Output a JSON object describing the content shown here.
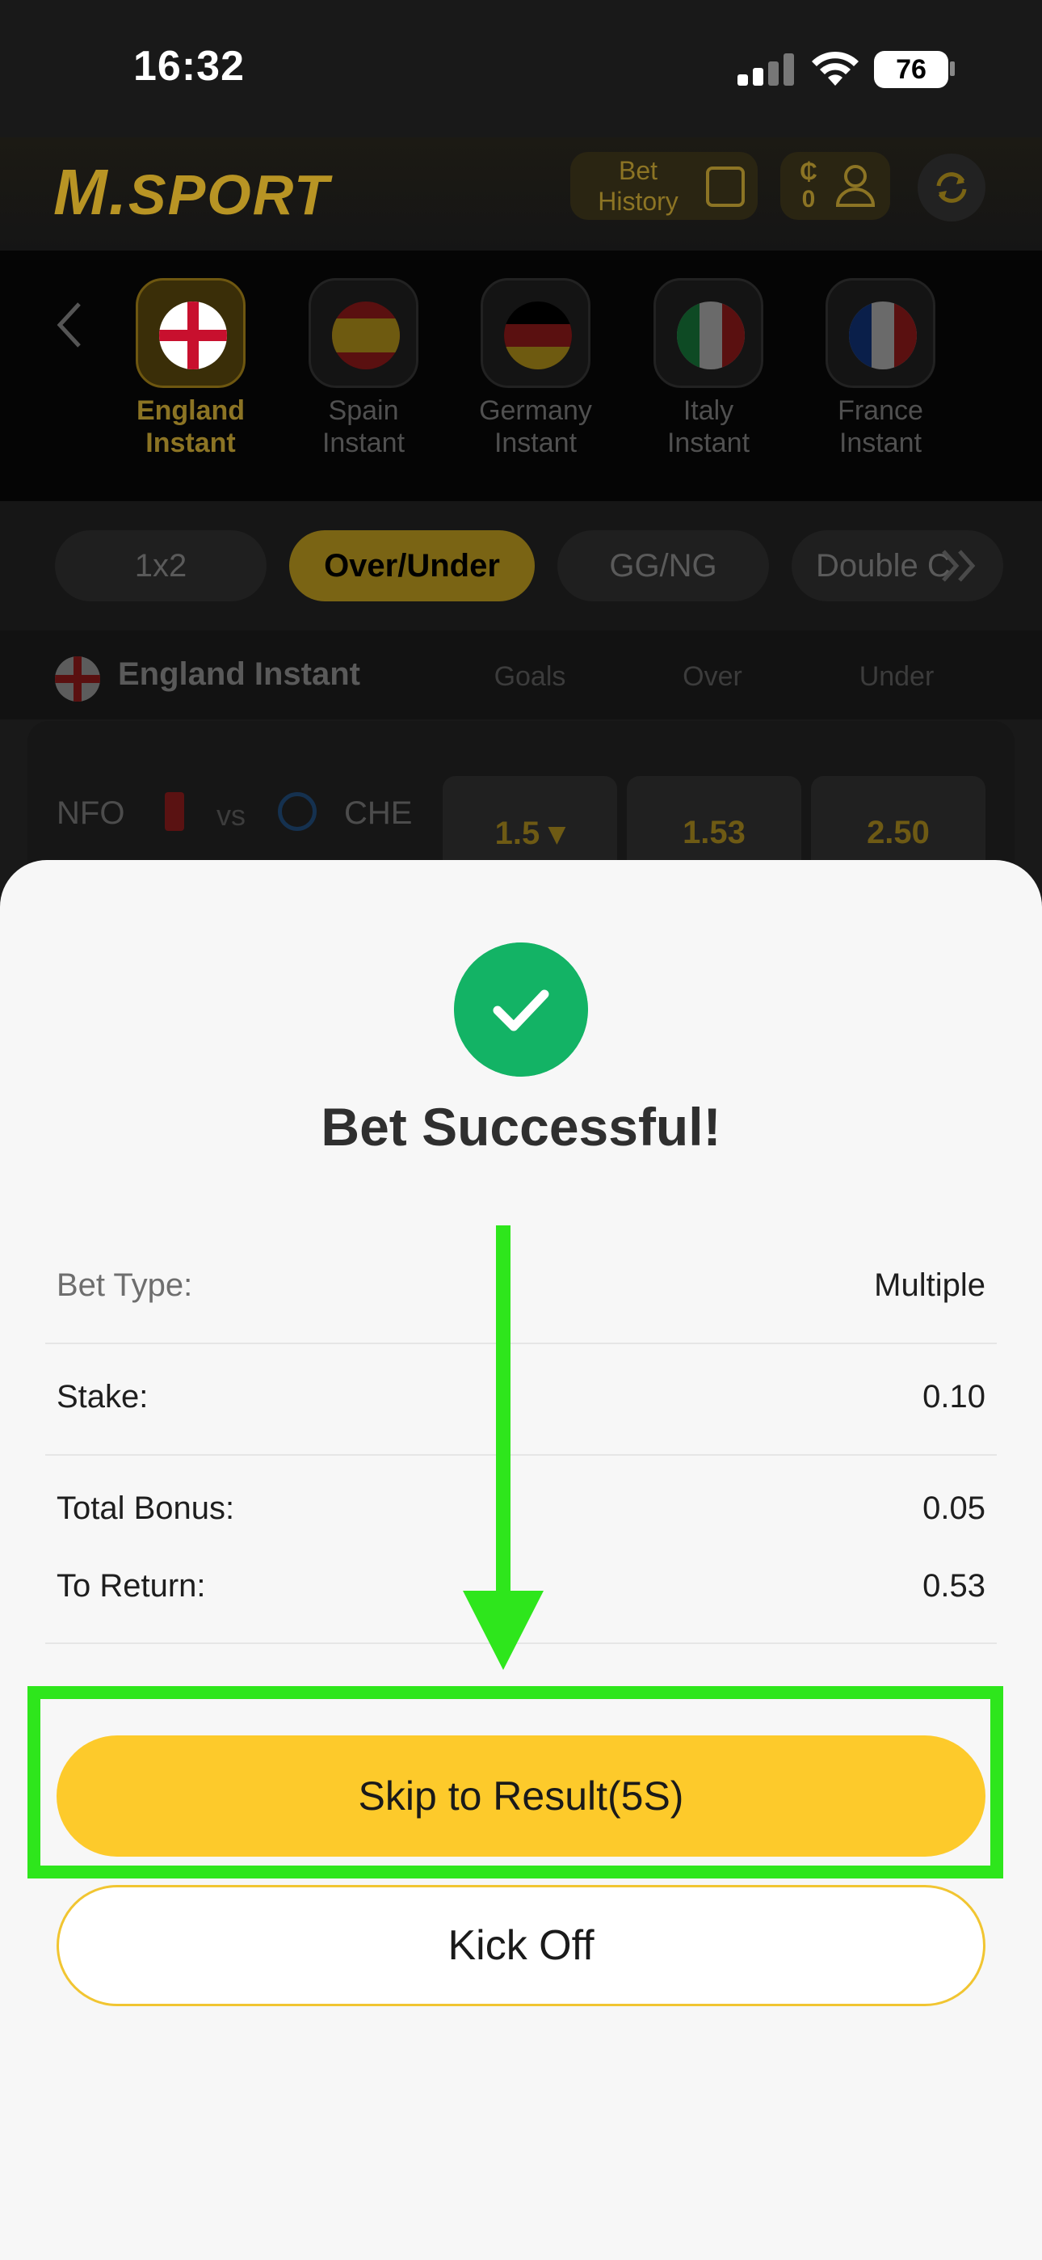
{
  "status_bar": {
    "time": "16:32",
    "battery": "76"
  },
  "header": {
    "logo": "SPORT",
    "bet_history_line1": "Bet",
    "bet_history_line2": "History",
    "currency": "₵",
    "balance": "0"
  },
  "leagues": [
    {
      "line1": "England",
      "line2": "Instant",
      "active": true
    },
    {
      "line1": "Spain",
      "line2": "Instant",
      "active": false
    },
    {
      "line1": "Germany",
      "line2": "Instant",
      "active": false
    },
    {
      "line1": "Italy",
      "line2": "Instant",
      "active": false
    },
    {
      "line1": "France",
      "line2": "Instant",
      "active": false
    }
  ],
  "market_tabs": [
    "1x2",
    "Over/Under",
    "GG/NG",
    "Double C"
  ],
  "active_market": "Over/Under",
  "league_header": {
    "title": "England Instant",
    "col_goals": "Goals",
    "col_over": "Over",
    "col_under": "Under"
  },
  "match": {
    "home": "NFO",
    "vs": "vs",
    "away": "CHE",
    "goals": "1.5",
    "over": "1.53",
    "under": "2.50"
  },
  "modal": {
    "title": "Bet Successful!",
    "bet_type_label": "Bet Type:",
    "bet_type_value": "Multiple",
    "stake_label": "Stake:",
    "stake_value": "0.10",
    "total_bonus_label": "Total Bonus:",
    "total_bonus_value": "0.05",
    "to_return_label": "To Return:",
    "to_return_value": "0.53",
    "skip_button": "Skip to Result(5S)",
    "kickoff_button": "Kick Off"
  },
  "colors": {
    "accent_yellow": "#fdca2b",
    "success_green": "#13b365",
    "annotation_green": "#2ee61c"
  }
}
